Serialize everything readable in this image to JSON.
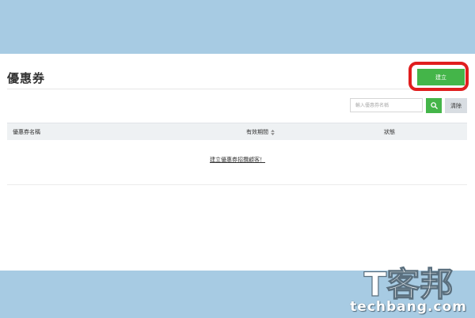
{
  "page": {
    "title": "優惠券"
  },
  "toolbar": {
    "create_label": "建立",
    "search_placeholder": "輸入優惠券名稱",
    "search_icon": "search-icon",
    "clear_label": "清除"
  },
  "table": {
    "columns": [
      {
        "label": "優惠券名稱"
      },
      {
        "label": "有效期間",
        "sort_icon": "sort-icon"
      },
      {
        "label": "狀態"
      }
    ],
    "empty_link": "建立優惠券招攬顧客！"
  },
  "watermark": {
    "logo_text": "T客邦",
    "url": "techbang.com"
  },
  "colors": {
    "accent_green": "#44b549",
    "background_blue": "#a7cbe3",
    "highlight_red": "#e01e1e"
  }
}
